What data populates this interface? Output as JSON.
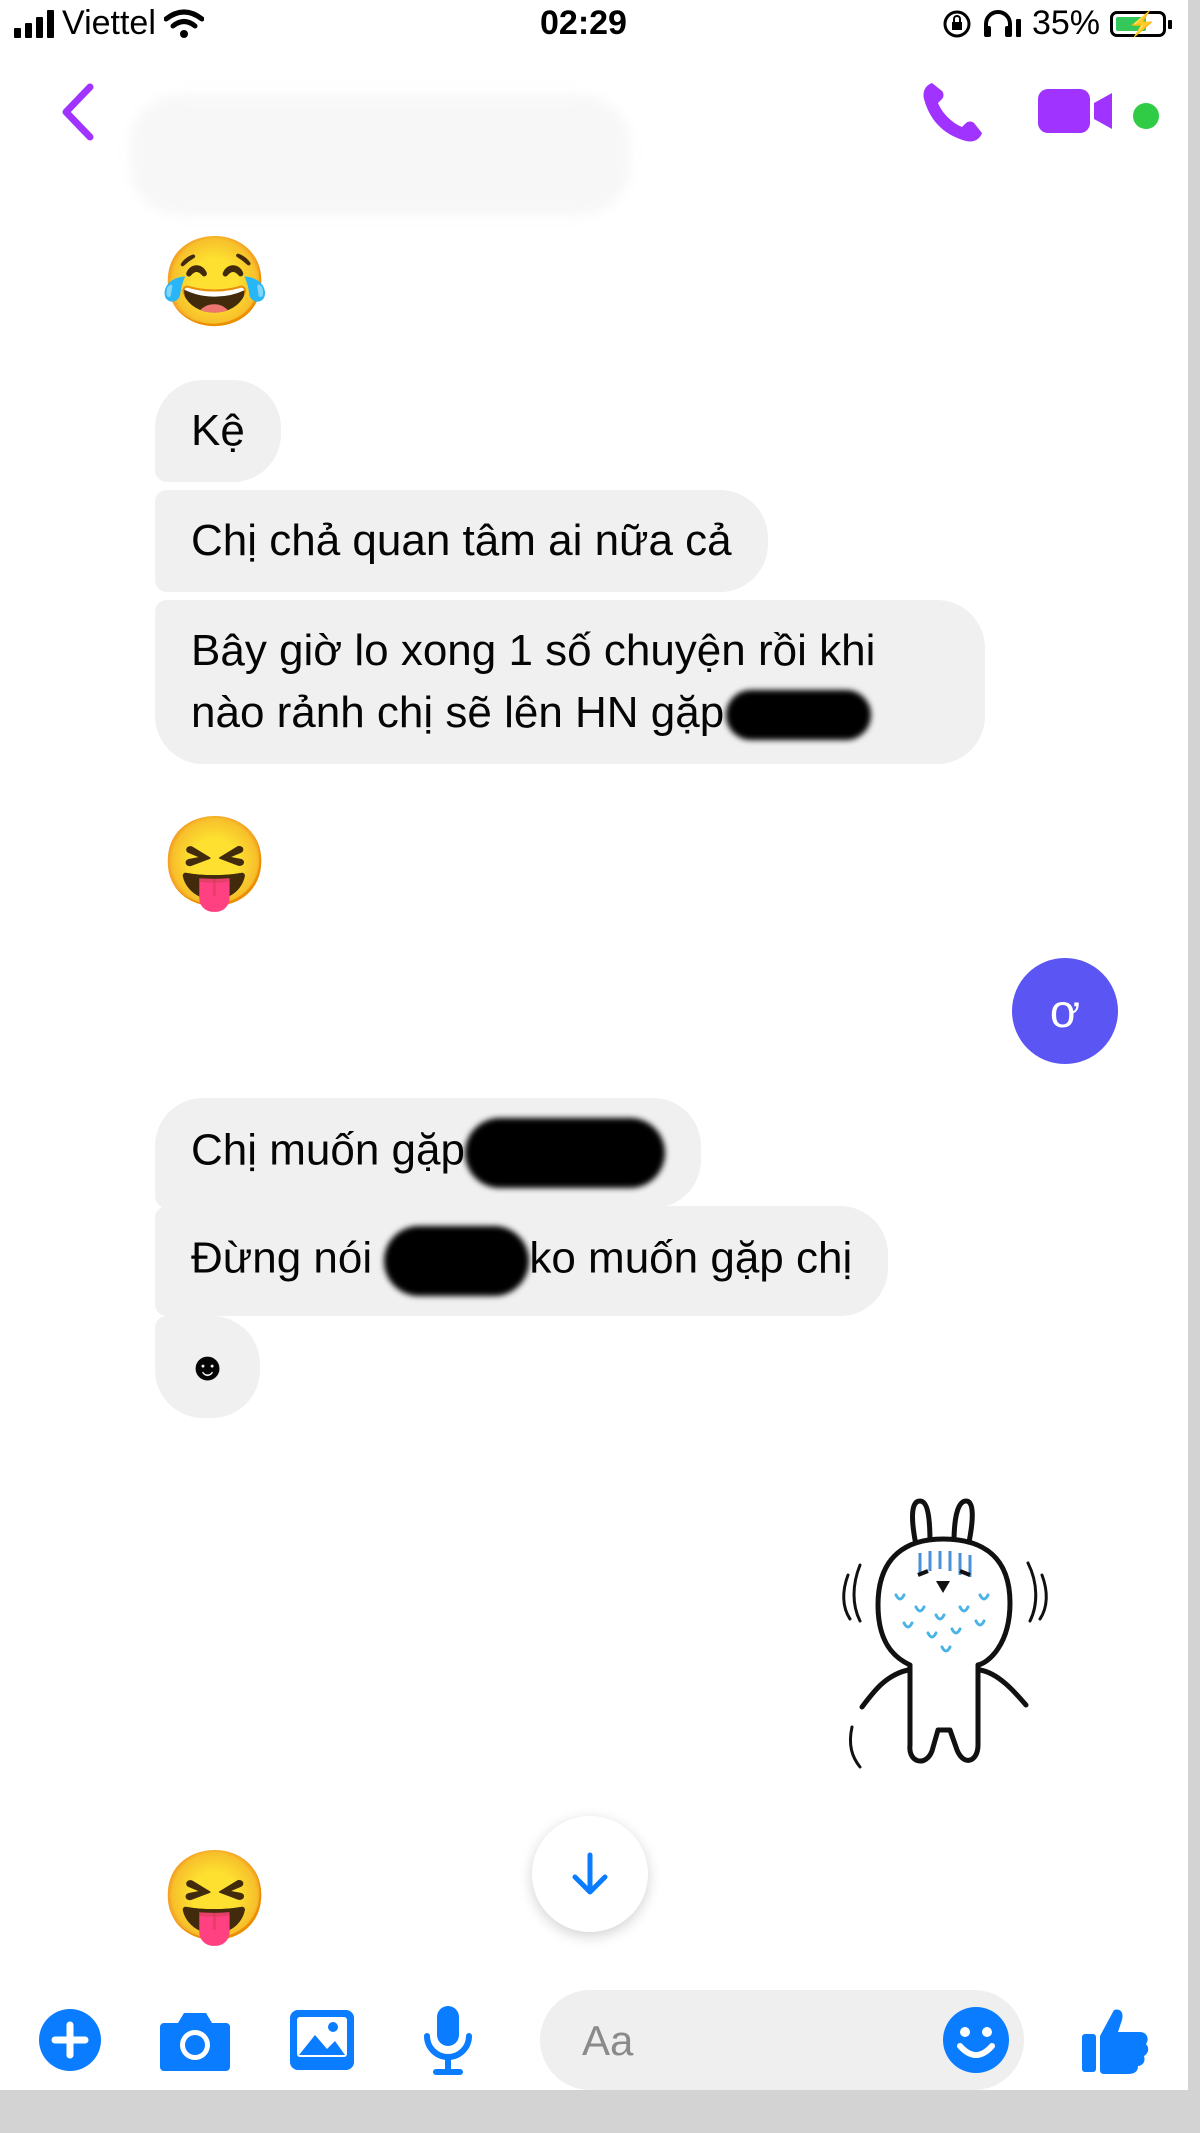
{
  "status_bar": {
    "carrier": "Viettel",
    "time": "02:29",
    "battery": "35%"
  },
  "messages": {
    "emoji_laugh": "😂",
    "msg_1": "Kệ",
    "msg_2": "Chị chả quan tâm ai nữa cả",
    "msg_3_line1": "Bây giờ lo xong 1 số chuyện rồi khi",
    "msg_3_line2": "nào rảnh chị sẽ lên HN gặp",
    "emoji_tongue": "😝",
    "sent_msg": "ơ",
    "msg_4": "Chị muốn gặp",
    "msg_5_a": "Đừng nói",
    "msg_5_b": "ko muốn gặp chị",
    "msg_6": "☻",
    "emoji_tongue_2": "😝"
  },
  "composer": {
    "placeholder": "Aa"
  },
  "colors": {
    "accent_purple": "#a033ff",
    "sent_bubble": "#5b55f3",
    "messenger_blue": "#0a7cff",
    "online_green": "#31cc46"
  },
  "icons": [
    "back-chevron-icon",
    "phone-icon",
    "video-camera-icon",
    "plus-icon",
    "camera-icon",
    "image-icon",
    "microphone-icon",
    "smiley-icon",
    "thumbs-up-icon",
    "arrow-down-icon"
  ]
}
